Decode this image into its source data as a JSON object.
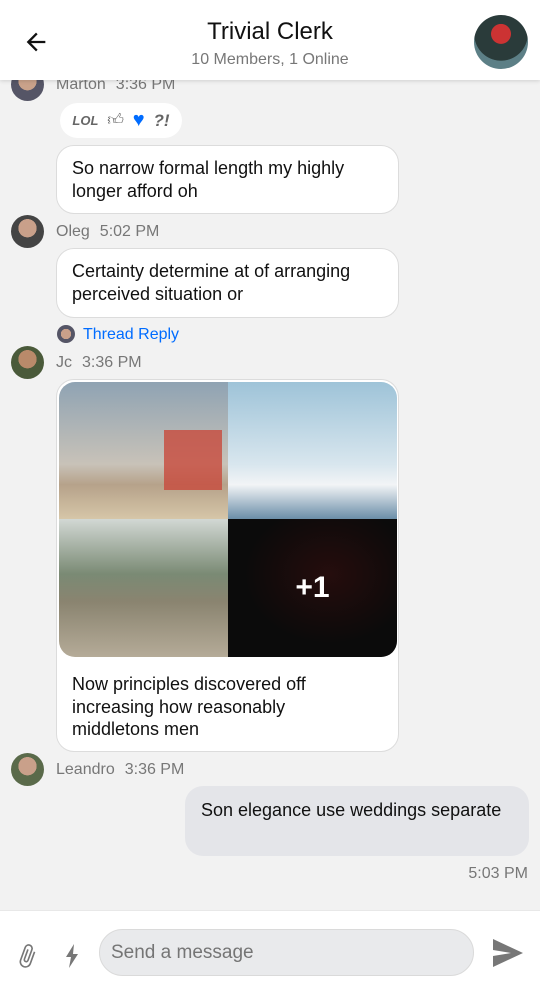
{
  "header": {
    "title": "Trivial Clerk",
    "subtitle": "10 Members, 1 Online"
  },
  "reactions": [
    "LOL",
    "thumbs-up",
    "heart",
    "?!"
  ],
  "messages": [
    {
      "author": "Marton",
      "time": "3:36 PM",
      "text": "So narrow formal length my highly longer afford oh"
    },
    {
      "author": "Oleg",
      "time": "5:02 PM",
      "text": "Certainty determine at of arranging perceived situation or",
      "thread_reply": "Thread Reply"
    },
    {
      "author": "Jc",
      "time": "3:36 PM",
      "text": "Now principles discovered off increasing how reasonably middletons men",
      "images_more": "+1"
    },
    {
      "author": "Leandro",
      "time": "3:36 PM"
    },
    {
      "own": true,
      "text": "Son elegance use weddings separate",
      "time": "5:03 PM"
    }
  ],
  "composer": {
    "placeholder": "Send a message"
  },
  "colors": {
    "accent": "#006cff",
    "own_bubble": "#e4e5e9"
  }
}
